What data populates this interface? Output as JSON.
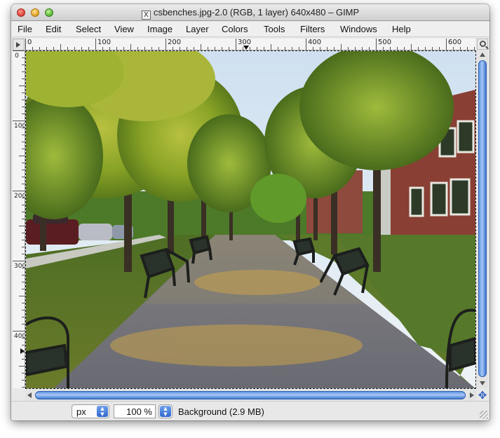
{
  "window": {
    "title": "csbenches.jpg-2.0 (RGB, 1 layer) 640x480 – GIMP",
    "title_icon_glyph": "X"
  },
  "menubar": {
    "items": [
      {
        "label": "File"
      },
      {
        "label": "Edit"
      },
      {
        "label": "Select"
      },
      {
        "label": "View"
      },
      {
        "label": "Image"
      },
      {
        "label": "Layer"
      },
      {
        "label": "Colors"
      },
      {
        "label": "Tools"
      },
      {
        "label": "Filters"
      },
      {
        "label": "Windows"
      },
      {
        "label": "Help"
      }
    ]
  },
  "rulers": {
    "horizontal_labels": [
      "0",
      "100",
      "200",
      "300",
      "400",
      "500",
      "600"
    ],
    "vertical_labels": [
      "0",
      "100",
      "200",
      "300",
      "400"
    ]
  },
  "statusbar": {
    "unit": "px",
    "zoom": "100 %",
    "layer_info": "Background (2.9 MB)"
  },
  "colors": {
    "scrollbar_accent": "#4a83dc",
    "sky": "#dfe9f4",
    "foliage": "#8aa424",
    "path": "#7a7570",
    "grass": "#5a7a2a",
    "brick": "#8a3f35"
  },
  "icons": [
    "close-icon",
    "minimize-icon",
    "maximize-icon",
    "image-file-icon",
    "ruler-menu-icon",
    "zoom-icon",
    "navigate-icon",
    "resize-grip-icon"
  ]
}
